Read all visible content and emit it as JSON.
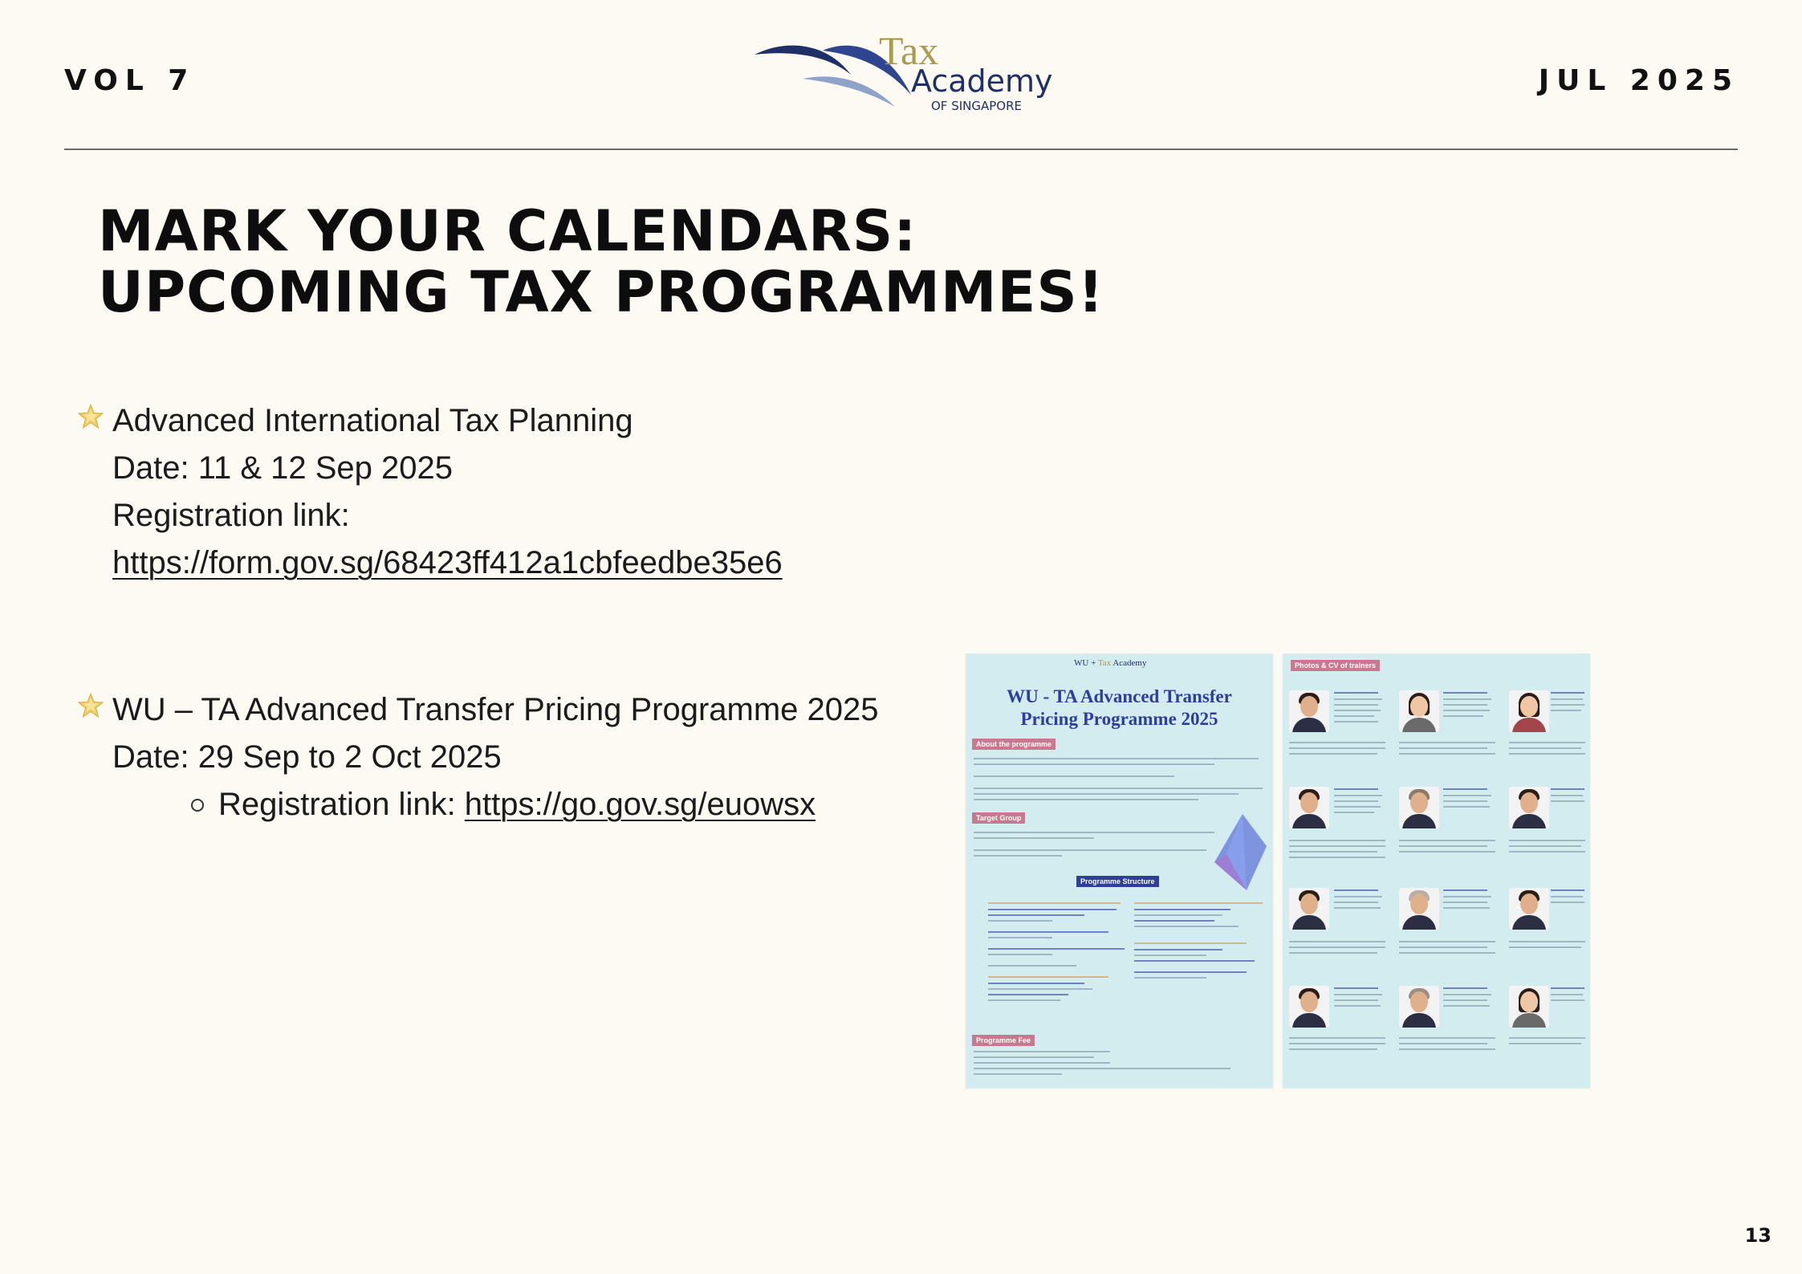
{
  "header": {
    "volume": "VOL 7",
    "issue_date": "JUL 2025",
    "logo": {
      "tax": "Tax",
      "academy": "Academy",
      "subtitle": "OF SINGAPORE"
    }
  },
  "title": {
    "line1": "MARK YOUR CALENDARS:",
    "line2": "UPCOMING TAX PROGRAMMES!"
  },
  "programmes": [
    {
      "icon": "star-icon",
      "name": "Advanced International Tax Planning",
      "date": "Date: 11 & 12 Sep 2025",
      "registration_label": "Registration link:",
      "registration_url": "https://form.gov.sg/68423ff412a1cbfeedbe35e6"
    },
    {
      "icon": "star-icon",
      "name": "WU – TA Advanced Transfer Pricing Programme 2025",
      "date": "Date: 29 Sep to 2 Oct 2025",
      "registration_label": "Registration link: ",
      "registration_url": "https://go.gov.sg/euowsx"
    }
  ],
  "brochure": {
    "title_line1": "WU - TA Advanced Transfer",
    "title_line2": "Pricing Programme 2025",
    "sections": [
      "About the programme",
      "Target Group",
      "Programme Structure",
      "Programme Fee"
    ],
    "trainers_heading": "Photos & CV of trainers"
  },
  "page_number": "13",
  "colors": {
    "background": "#fdfaf3",
    "brochure_bg": "#d3ecef",
    "brand_navy": "#1f2f68",
    "brand_gold": "#a89a4e"
  }
}
